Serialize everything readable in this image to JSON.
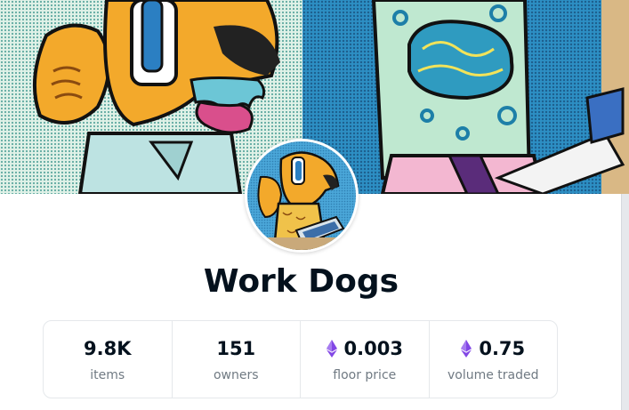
{
  "collection": {
    "name": "Work Dogs"
  },
  "stats": [
    {
      "value": "9.8K",
      "label": "items",
      "icon": null
    },
    {
      "value": "151",
      "label": "owners",
      "icon": null
    },
    {
      "value": "0.003",
      "label": "floor price",
      "icon": "ethereum-icon"
    },
    {
      "value": "0.75",
      "label": "volume traded",
      "icon": "ethereum-icon"
    }
  ],
  "colors": {
    "title": "#04111d",
    "label": "#707a83",
    "border": "#e5e8eb",
    "eth": "#8247e5"
  }
}
